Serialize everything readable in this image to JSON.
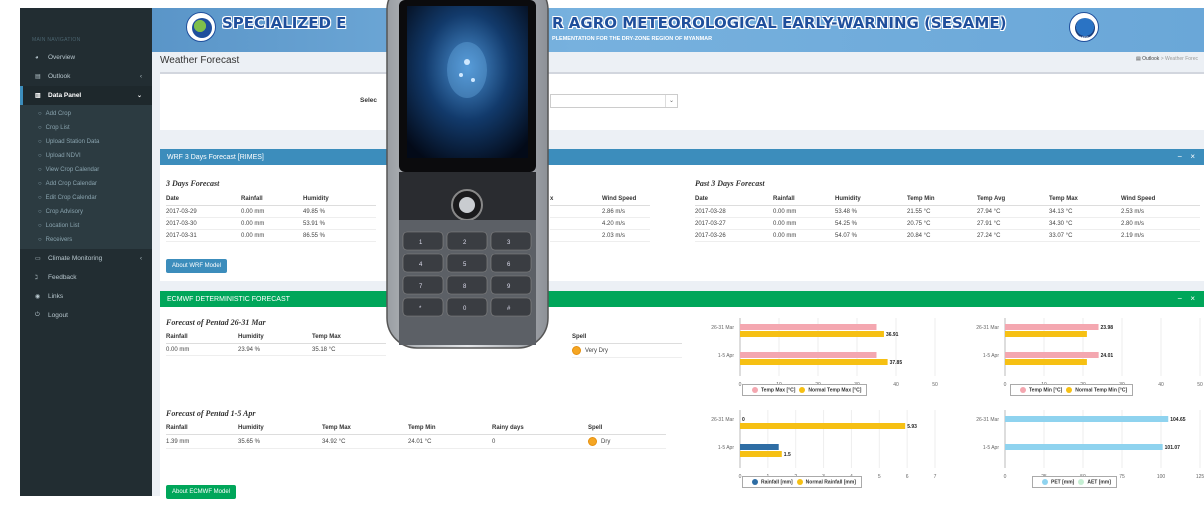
{
  "sidebar": {
    "nav_title": "MAIN NAVIGATION",
    "items": [
      {
        "label": "Overview",
        "icon": "dashboard-icon"
      },
      {
        "label": "Outlook",
        "icon": "table-icon"
      },
      {
        "label": "Data Panel",
        "icon": "panel-icon"
      },
      {
        "label": "Climate Monitoring",
        "icon": "monitor-icon"
      },
      {
        "label": "Feedback",
        "icon": "rss-icon"
      },
      {
        "label": "Links",
        "icon": "globe-icon"
      },
      {
        "label": "Logout",
        "icon": "power-icon"
      }
    ],
    "sub_items": [
      "Add Crop",
      "Crop List",
      "Upload Station Data",
      "Upload NDVI",
      "View Crop Calendar",
      "Add Crop Calendar",
      "Edit Crop Calendar",
      "Crop Advisory",
      "Location List",
      "Receivers"
    ]
  },
  "banner": {
    "title_left": "SPECIALIZED E",
    "title_right": "R AGRO METEOROLOGICAL EARLY-WARNING (SESAME)",
    "subtitle": "PLEMENTATION FOR THE DRY-ZONE REGION OF MYANMAR",
    "logo2_text": "RIMES"
  },
  "page": {
    "title": "Weather Forecast",
    "breadcrumb_1": "Outlook",
    "breadcrumb_sep": ">",
    "breadcrumb_2": "Weather Forec",
    "select_label": "Selec"
  },
  "wrf": {
    "header": "WRF 3 Days Forecast [RIMES]",
    "tools": "− ×",
    "forecast_title": "3 Days Forecast",
    "forecast_cols": [
      "Date",
      "Rainfall",
      "Humidity"
    ],
    "forecast_cols_right": [
      "x",
      "Wind Speed"
    ],
    "forecast_rows": [
      {
        "date": "2017-03-29",
        "rain": "0.00 mm",
        "hum": "49.85 %",
        "wind": "2.86 m/s"
      },
      {
        "date": "2017-03-30",
        "rain": "0.00 mm",
        "hum": "53.91 %",
        "wind": "4.20 m/s"
      },
      {
        "date": "2017-03-31",
        "rain": "0.00 mm",
        "hum": "86.55 %",
        "wind": "2.03 m/s"
      }
    ],
    "past_title": "Past 3 Days Forecast",
    "past_cols": [
      "Date",
      "Rainfall",
      "Humidity",
      "Temp Min",
      "Temp Avg",
      "Temp Max",
      "Wind Speed"
    ],
    "past_rows": [
      [
        "2017-03-28",
        "0.00 mm",
        "53.48 %",
        "21.55 °C",
        "27.94 °C",
        "34.13 °C",
        "2.53 m/s"
      ],
      [
        "2017-03-27",
        "0.00 mm",
        "54.25 %",
        "20.75 °C",
        "27.91 °C",
        "34.30 °C",
        "2.80 m/s"
      ],
      [
        "2017-03-26",
        "0.00 mm",
        "54.07 %",
        "20.84 °C",
        "27.24 °C",
        "33.07 °C",
        "2.19 m/s"
      ]
    ],
    "button": "About WRF Model"
  },
  "ecmwf": {
    "header": "ECMWF DETERMINISTIC FORECAST",
    "tools": "− ×",
    "p1_title": "Forecast of Pentad 26-31 Mar",
    "p1_cols": [
      "Rainfall",
      "Humidity",
      "Temp Max",
      "Spell"
    ],
    "p1_row": {
      "rain": "0.00 mm",
      "hum": "23.94 %",
      "tmax": "35.18 °C",
      "spell": "Very Dry"
    },
    "p2_title": "Forecast of Pentad 1-5 Apr",
    "p2_cols": [
      "Rainfall",
      "Humidity",
      "Temp Max",
      "Temp Min",
      "Rainy days",
      "Spell"
    ],
    "p2_row": {
      "rain": "1.39 mm",
      "hum": "35.65 %",
      "tmax": "34.92 °C",
      "tmin": "24.01 °C",
      "days": "0",
      "spell": "Dry"
    },
    "button": "About ECMWF Model"
  },
  "colors": {
    "pink": "#f4a7b0",
    "yellow": "#f6c013",
    "blue": "#2e6da4",
    "cyan": "#8fd3ef",
    "lightgreen": "#c5efd3",
    "spell": "#f5a623"
  },
  "chart_data": [
    {
      "type": "bar",
      "categories": [
        "26-31 Mar",
        "1-5 Apr"
      ],
      "series": [
        {
          "name": "Temp Max [°C]",
          "values": [
            35,
            35
          ]
        },
        {
          "name": "Normal Temp Max [°C]",
          "values": [
            36.91,
            37.85
          ]
        }
      ],
      "xlim": [
        0,
        50
      ],
      "ticks": [
        0,
        10,
        20,
        30,
        40,
        50
      ],
      "labels": [
        null,
        "36.91",
        null,
        "37.85"
      ]
    },
    {
      "type": "bar",
      "categories": [
        "26-31 Mar",
        "1-5 Apr"
      ],
      "series": [
        {
          "name": "Temp Min [°C]",
          "values": [
            23.98,
            24.01
          ]
        },
        {
          "name": "Normal Temp Min [°C]",
          "values": [
            21,
            21
          ]
        }
      ],
      "xlim": [
        0,
        50
      ],
      "ticks": [
        0,
        10,
        20,
        30,
        40,
        50
      ],
      "labels": [
        "23.98",
        null,
        "24.01",
        null
      ]
    },
    {
      "type": "bar",
      "categories": [
        "26-31 Mar",
        "1-5 Apr"
      ],
      "series": [
        {
          "name": "Rainfall [mm]",
          "values": [
            0,
            1.39
          ]
        },
        {
          "name": "Normal Rainfall [mm]",
          "values": [
            5.93,
            1.5
          ]
        }
      ],
      "xlim": [
        0,
        7
      ],
      "ticks": [
        0,
        1,
        2,
        3,
        4,
        5,
        6,
        7
      ],
      "labels": [
        "0",
        "5.93",
        null,
        "1.5"
      ]
    },
    {
      "type": "bar",
      "categories": [
        "26-31 Mar",
        "1-5 Apr"
      ],
      "series": [
        {
          "name": "PET [mm]",
          "values": [
            104.65,
            101.07
          ]
        },
        {
          "name": "AET [mm]",
          "values": [
            0,
            0
          ]
        }
      ],
      "xlim": [
        0,
        125
      ],
      "ticks": [
        0,
        25,
        50,
        75,
        100,
        125
      ],
      "labels": [
        "104.65",
        null,
        "101.07",
        null
      ]
    }
  ]
}
